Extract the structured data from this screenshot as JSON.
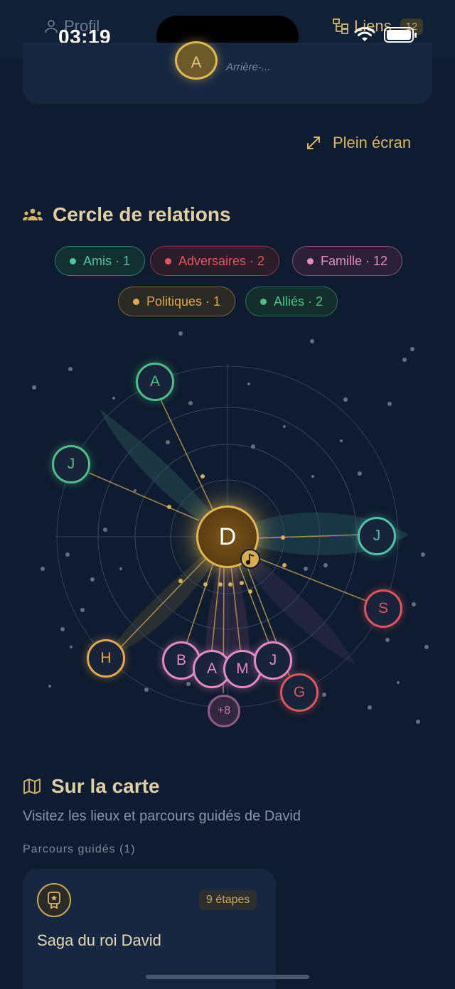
{
  "status": {
    "time": "03:19"
  },
  "tabs": {
    "profil": {
      "label": "Profil"
    },
    "liens": {
      "label": "Liens",
      "count": "12"
    }
  },
  "top_card": {
    "avatar_letter": "A",
    "caption": "Arrière-..."
  },
  "fullscreen": {
    "label": "Plein écran"
  },
  "relations": {
    "title": "Cercle de relations",
    "chips": [
      {
        "label": "Amis · 1",
        "color": "#4fc3a8"
      },
      {
        "label": "Adversaires · 2",
        "color": "#e0555f"
      },
      {
        "label": "Famille · 12",
        "color": "#e58bc0"
      },
      {
        "label": "Politiques · 1",
        "color": "#e0a84a"
      },
      {
        "label": "Alliés · 2",
        "color": "#4cc087"
      }
    ],
    "center": {
      "letter": "D"
    },
    "nodes": [
      {
        "letter": "A",
        "kind": "allie"
      },
      {
        "letter": "J",
        "kind": "allie"
      },
      {
        "letter": "J",
        "kind": "ami"
      },
      {
        "letter": "S",
        "kind": "adversaire"
      },
      {
        "letter": "H",
        "kind": "politique"
      },
      {
        "letter": "B",
        "kind": "famille"
      },
      {
        "letter": "A",
        "kind": "famille"
      },
      {
        "letter": "M",
        "kind": "famille"
      },
      {
        "letter": "J",
        "kind": "famille"
      },
      {
        "letter": "G",
        "kind": "adversaire"
      }
    ],
    "more": "+8"
  },
  "map": {
    "title": "Sur la carte",
    "subtitle": "Visitez les lieux et parcours guidés de David",
    "tours_label": "Parcours guidés (1)",
    "tour": {
      "steps": "9 étapes",
      "title": "Saga du roi David"
    }
  },
  "colors": {
    "accent": "#d7b665",
    "background": "#0f1b2e",
    "card": "#172741"
  }
}
